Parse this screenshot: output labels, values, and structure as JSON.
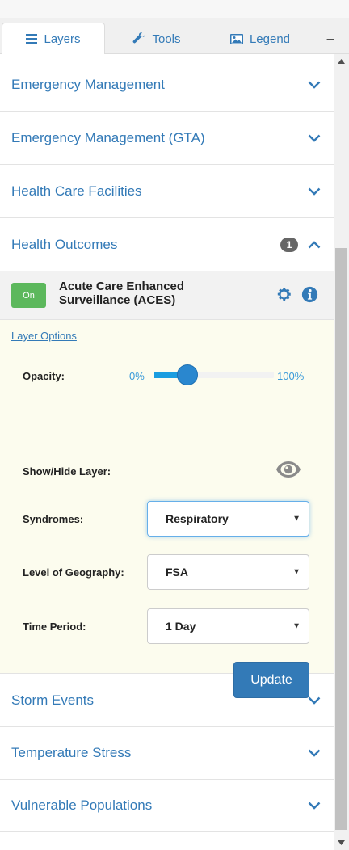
{
  "tabs": {
    "layers": "Layers",
    "tools": "Tools",
    "legend": "Legend",
    "collapse_symbol": "–"
  },
  "categories_top": [
    {
      "title": "Emergency Management"
    },
    {
      "title": "Emergency Management (GTA)"
    },
    {
      "title": "Health Care Facilities"
    }
  ],
  "health_outcomes": {
    "title": "Health Outcomes",
    "badge": "1",
    "layer": {
      "toggle_label": "On",
      "name": "Acute Care Enhanced Surveillance (ACES)"
    },
    "options": {
      "link": "Layer Options",
      "opacity_label": "Opacity:",
      "opacity_min": "0%",
      "opacity_max": "100%",
      "opacity_value": 0.28,
      "show_hide_label": "Show/Hide Layer:",
      "syndromes_label": "Syndromes:",
      "syndromes_value": "Respiratory",
      "geography_label": "Level of Geography:",
      "geography_value": "FSA",
      "time_label": "Time Period:",
      "time_value": "1 Day",
      "update_label": "Update"
    }
  },
  "categories_bottom": [
    {
      "title": "Storm Events"
    },
    {
      "title": "Temperature Stress"
    },
    {
      "title": "Vulnerable Populations"
    }
  ],
  "colors": {
    "link_blue": "#337ab7",
    "toggle_green": "#5cb85c",
    "slider_blue": "#1a9de0",
    "options_bg": "#fcfcee"
  }
}
